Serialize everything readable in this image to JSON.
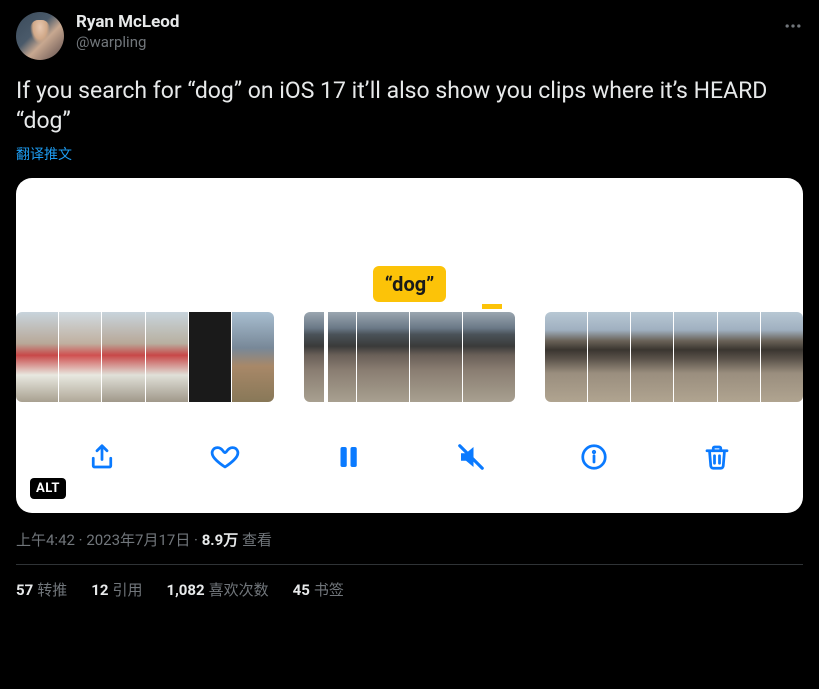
{
  "author": {
    "display_name": "Ryan McLeod",
    "handle": "@warpling"
  },
  "body": "If you search for “dog” on iOS 17 it’ll also show you clips where it’s HEARD “dog”",
  "translate_label": "翻译推文",
  "media": {
    "caption": "“dog”",
    "alt_badge": "ALT"
  },
  "meta": {
    "time": "上午4:42",
    "dot1": " · ",
    "date": "2023年7月17日",
    "dot2": " · ",
    "views_count": "8.9万",
    "views_label": " 查看"
  },
  "stats": {
    "retweets": {
      "count": "57",
      "label": "转推"
    },
    "quotes": {
      "count": "12",
      "label": "引用"
    },
    "likes": {
      "count": "1,082",
      "label": "喜欢次数"
    },
    "bookmarks": {
      "count": "45",
      "label": "书签"
    }
  }
}
